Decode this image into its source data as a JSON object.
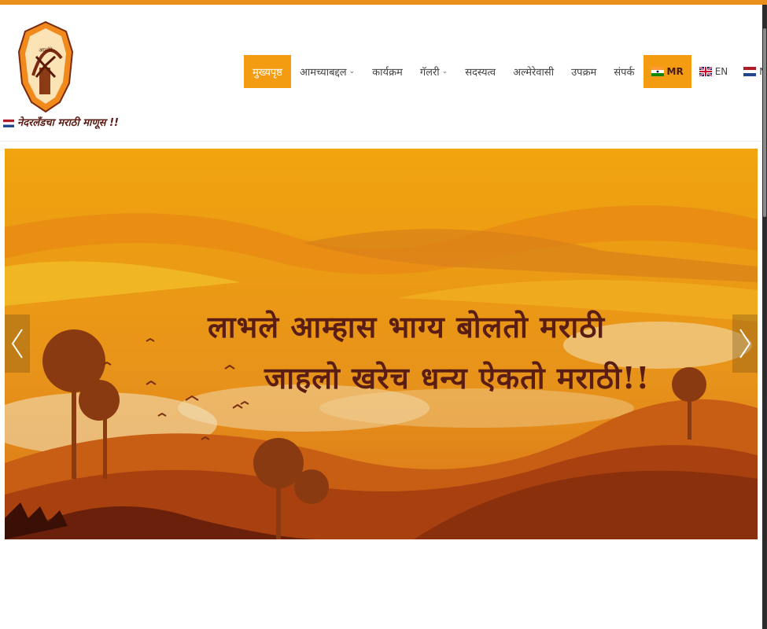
{
  "tagline": "नेदरलँडचा मराठी माणूस !!",
  "nav": {
    "items": [
      {
        "label": "मुख्यपृष्ठ",
        "active": true,
        "dropdown": false
      },
      {
        "label": "आमच्याबद्दल",
        "active": false,
        "dropdown": true
      },
      {
        "label": "कार्यक्रम",
        "active": false,
        "dropdown": false
      },
      {
        "label": "गॅलरी",
        "active": false,
        "dropdown": true
      },
      {
        "label": "सदस्यत्व",
        "active": false,
        "dropdown": false
      },
      {
        "label": "अल्मेरेवासी",
        "active": false,
        "dropdown": false
      },
      {
        "label": "उपक्रम",
        "active": false,
        "dropdown": false
      },
      {
        "label": "संपर्क",
        "active": false,
        "dropdown": false
      }
    ],
    "languages": [
      {
        "code": "MR",
        "flag": "india-flag-icon",
        "active": true
      },
      {
        "code": "EN",
        "flag": "uk-flag-icon",
        "active": false
      },
      {
        "code": "NL",
        "flag": "netherlands-flag-icon",
        "active": false
      }
    ]
  },
  "banner": {
    "line1": "लाभले आम्हास भाग्य बोलतो मराठी",
    "line2": "जाहलो खरेच धन्य ऐकतो मराठी!!"
  },
  "colors": {
    "accent": "#f39c12",
    "topbar": "#e8901a",
    "slogan": "#5a1d14"
  }
}
